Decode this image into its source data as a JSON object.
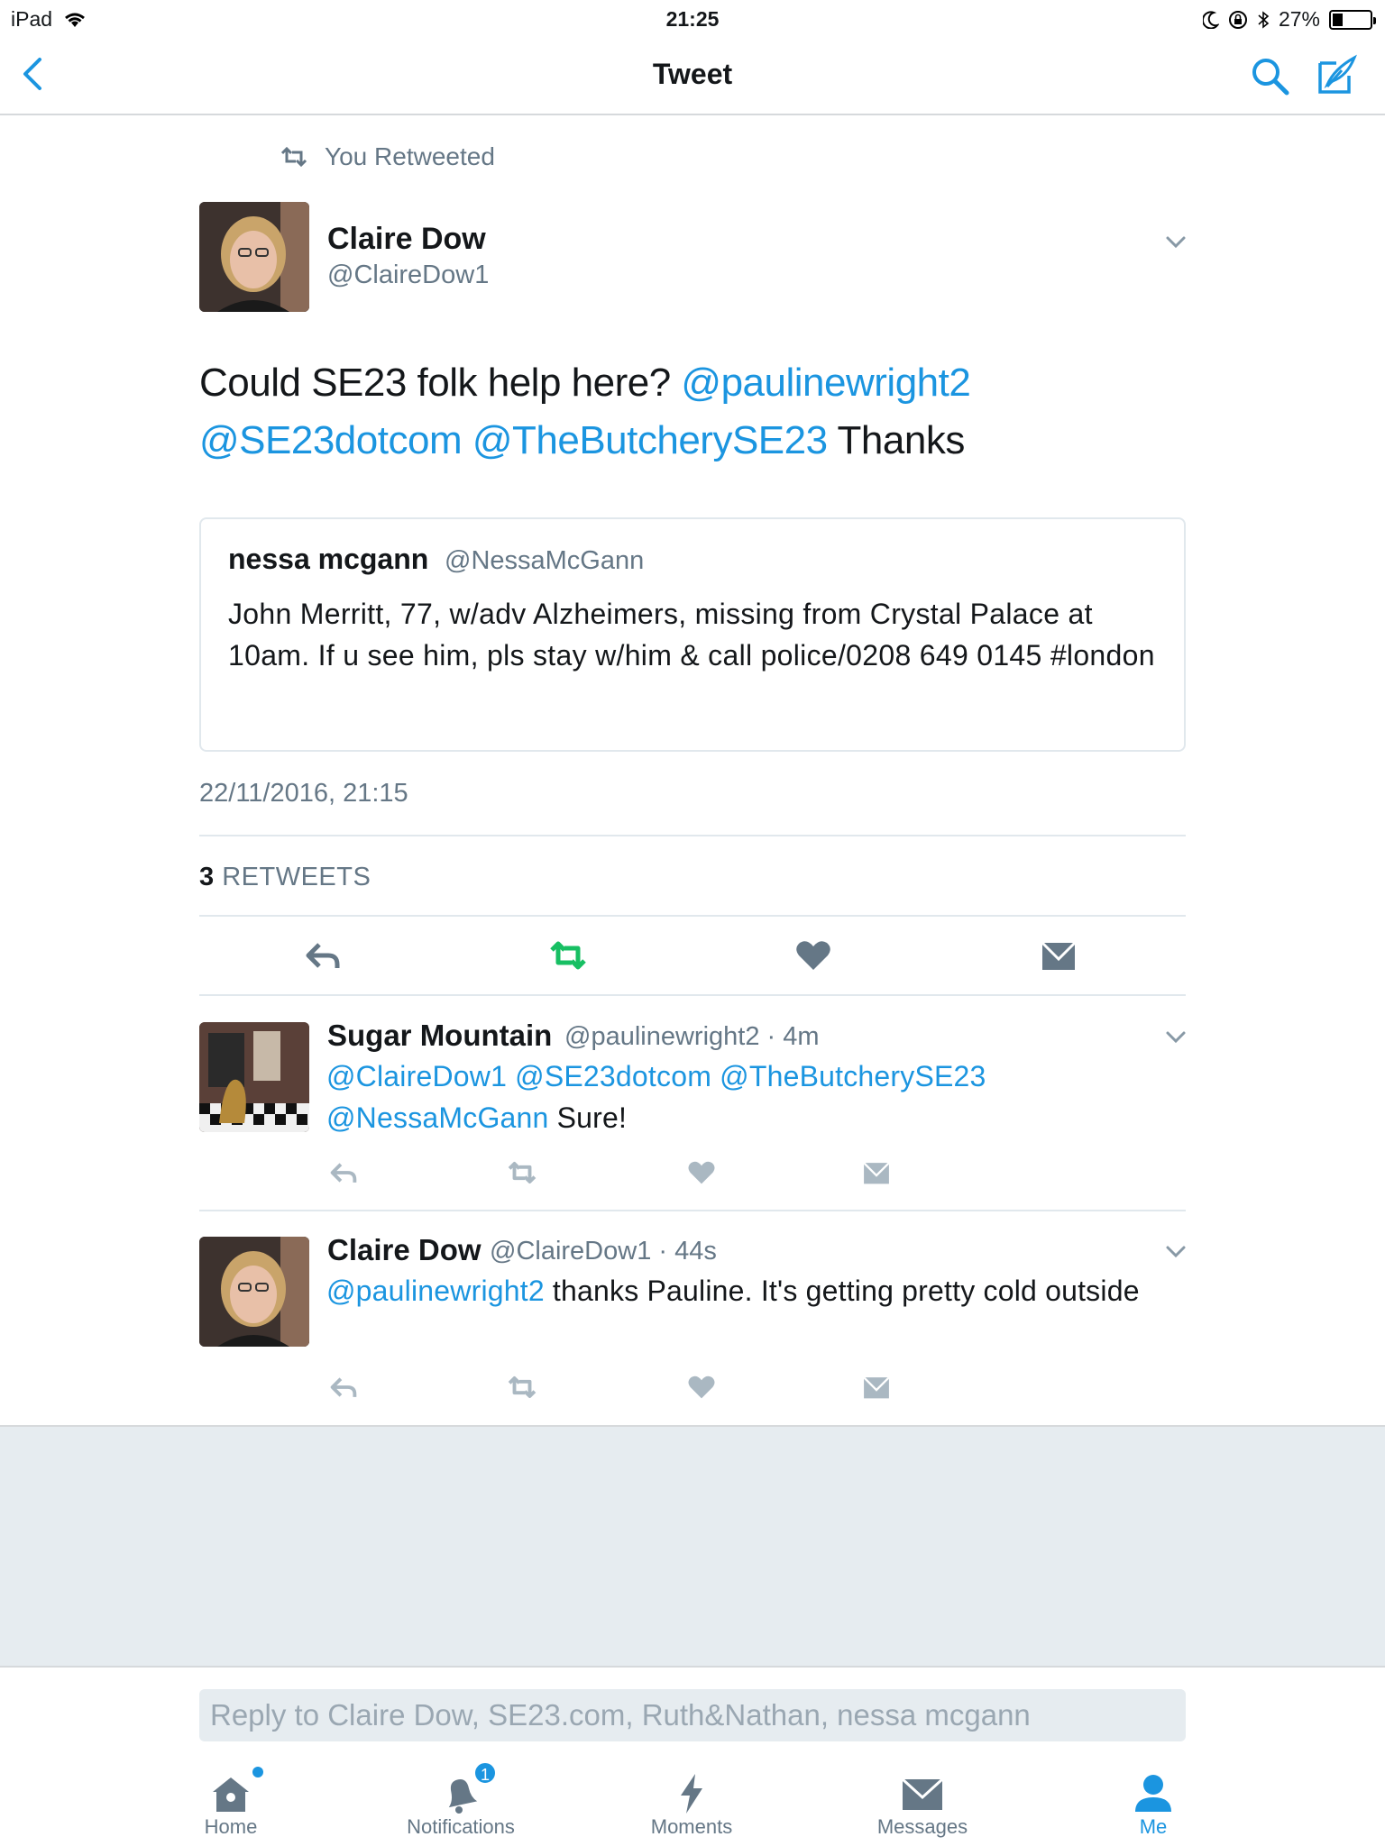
{
  "status_bar": {
    "device": "iPad",
    "time": "21:25",
    "battery_percent": "27%",
    "battery_level": 0.27
  },
  "nav": {
    "title": "Tweet"
  },
  "main_tweet": {
    "retweet_label": "You Retweeted",
    "author_name": "Claire Dow",
    "author_handle": "@ClaireDow1",
    "text_parts": {
      "p1": "Could SE23 folk help here? ",
      "m1": "@paulinewright2",
      "m2": "@SE23dotcom",
      "m3": "@TheButcherySE23",
      "p2": " Thanks"
    },
    "quoted": {
      "name": "nessa mcgann",
      "handle": "@NessaMcGann",
      "text": "John Merritt, 77, w/adv Alzheimers, missing from Crystal Palace at 10am. If u see him, pls stay w/him & call police/0208 649 0145 #london"
    },
    "timestamp": "22/11/2016, 21:15",
    "retweet_count": "3",
    "retweet_count_label": "RETWEETS"
  },
  "replies": [
    {
      "name": "Sugar Mountain",
      "meta": "@paulinewright2 · 4m",
      "mentions_line1": "@ClaireDow1 @SE23dotcom @TheButcherySE23",
      "mention_line2": "@NessaMcGann",
      "text": " Sure!"
    },
    {
      "name": "Claire Dow",
      "meta": "@ClaireDow1 · 44s",
      "mention": "@paulinewright2",
      "text": " thanks Pauline. It's getting pretty cold outside"
    }
  ],
  "reply_bar": {
    "placeholder": "Reply to Claire Dow, SE23.com, Ruth&Nathan, nessa mcgann"
  },
  "tabs": [
    {
      "label": "Home"
    },
    {
      "label": "Notifications",
      "badge": "1"
    },
    {
      "label": "Moments"
    },
    {
      "label": "Messages"
    },
    {
      "label": "Me"
    }
  ],
  "colors": {
    "accent": "#1b95e0",
    "retweet_active": "#17bf63",
    "icon_grey": "#657786",
    "background_grey": "#e6ecf0"
  }
}
